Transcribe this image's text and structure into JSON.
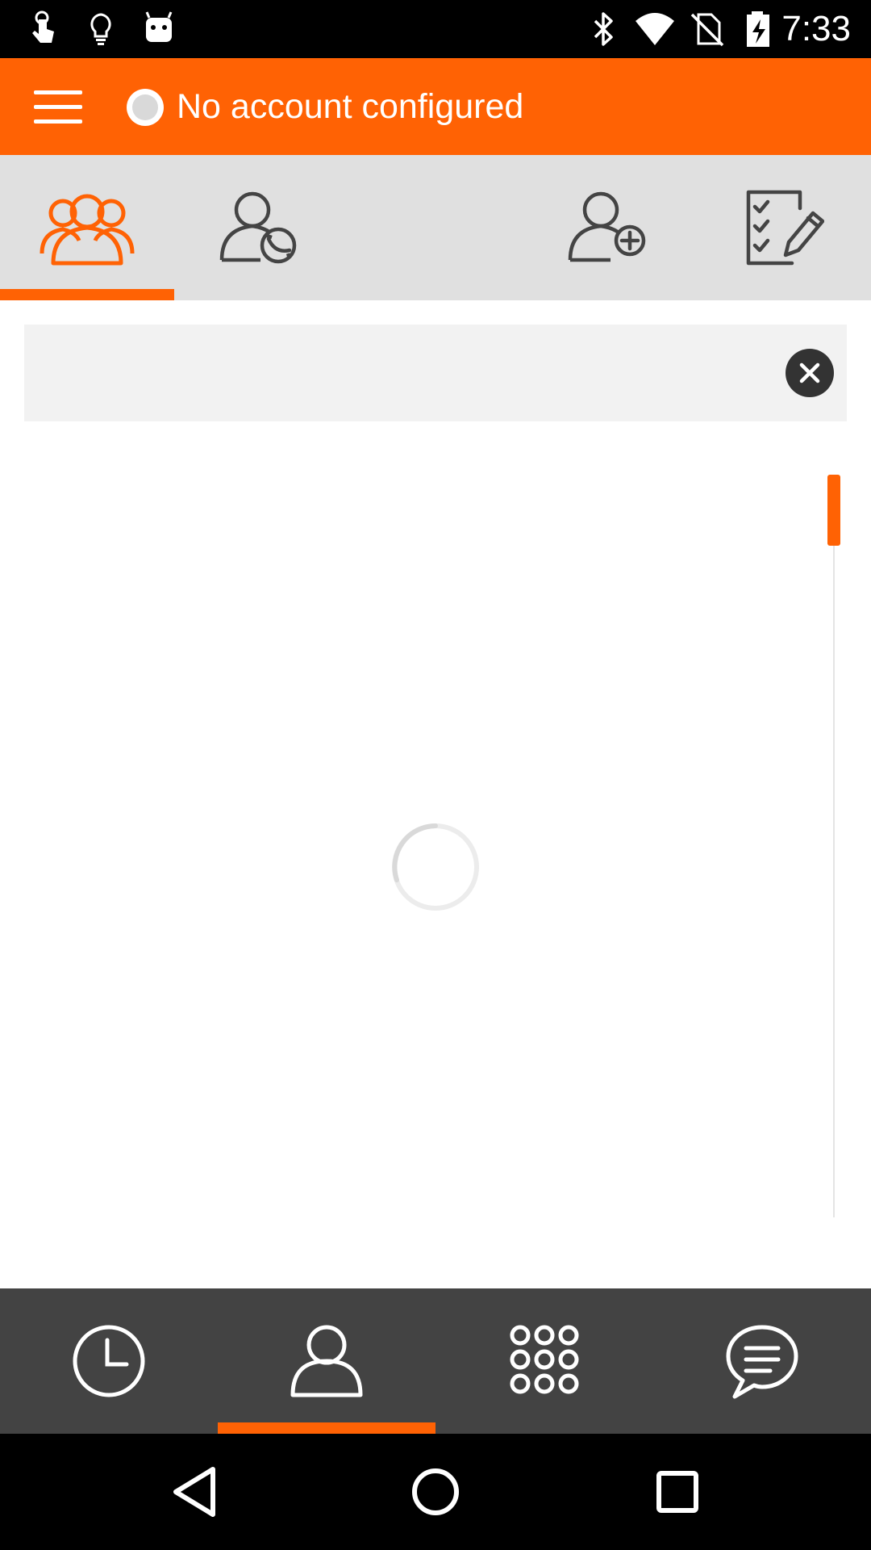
{
  "status_bar": {
    "time": "7:33",
    "left_icons": [
      "touch-gesture-icon",
      "lightbulb-icon",
      "android-icon"
    ],
    "right_icons": [
      "bluetooth-icon",
      "wifi-icon",
      "no-sim-icon",
      "battery-charging-icon"
    ]
  },
  "toolbar": {
    "account_title": "No account configured",
    "menu_icon": "hamburger-menu-icon",
    "status_indicator": "offline"
  },
  "top_tabs": [
    {
      "name": "all-contacts",
      "icon": "group-icon",
      "active": true
    },
    {
      "name": "sip-contacts",
      "icon": "contact-phone-icon",
      "active": false
    },
    {
      "name": "add-contact",
      "icon": "add-contact-icon",
      "active": false
    },
    {
      "name": "contact-list-edit",
      "icon": "checklist-edit-icon",
      "active": false
    }
  ],
  "search": {
    "value": "",
    "placeholder": ""
  },
  "bottom_nav": [
    {
      "name": "history",
      "icon": "clock-icon",
      "active": false
    },
    {
      "name": "contacts",
      "icon": "person-icon",
      "active": true
    },
    {
      "name": "dialpad",
      "icon": "dialpad-icon",
      "active": false
    },
    {
      "name": "chat",
      "icon": "chat-icon",
      "active": false
    }
  ],
  "colors": {
    "accent": "#ff6204",
    "tab_background": "#e0e0e0",
    "bottom_nav_background": "#434343",
    "icon_inactive": "#444444"
  }
}
